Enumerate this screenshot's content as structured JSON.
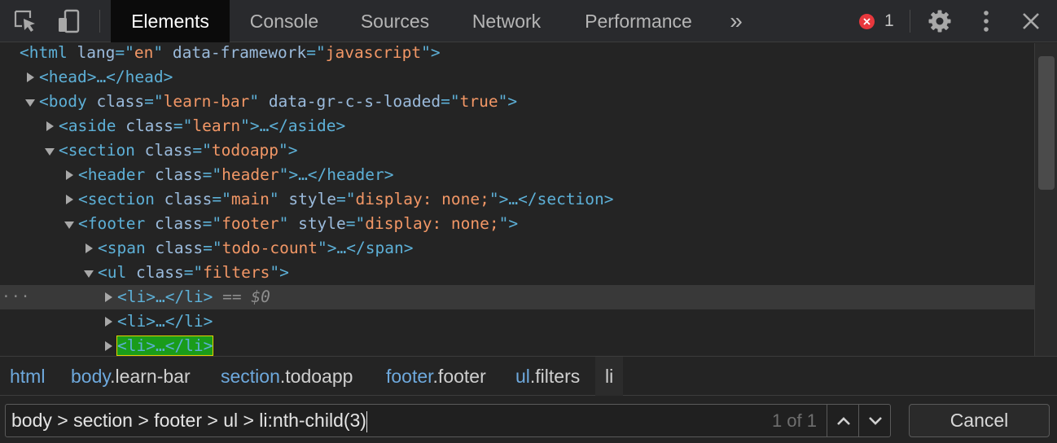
{
  "toolbar": {
    "tabs": [
      "Elements",
      "Console",
      "Sources",
      "Network",
      "Performance"
    ],
    "more_tabs_label": "»",
    "error_count": "1",
    "icons": [
      "inspect-element-icon",
      "device-toggle-icon",
      "gear-icon",
      "kebab-menu-icon",
      "close-icon"
    ]
  },
  "dom": {
    "html_open": {
      "tag": "<html",
      "attrs": [
        [
          "lang",
          "en"
        ],
        [
          "data-framework",
          "javascript"
        ]
      ],
      "close": ">"
    },
    "head": "<head>…</head>",
    "body_open": {
      "tag": "<body",
      "attrs": [
        [
          "class",
          "learn-bar"
        ],
        [
          "data-gr-c-s-loaded",
          "true"
        ]
      ],
      "close": ">"
    },
    "aside": {
      "tag": "<aside",
      "attrs": [
        [
          "class",
          "learn"
        ]
      ],
      "tail": ">…</aside>"
    },
    "section_open": {
      "tag": "<section",
      "attrs": [
        [
          "class",
          "todoapp"
        ]
      ],
      "close": ">"
    },
    "header": {
      "tag": "<header",
      "attrs": [
        [
          "class",
          "header"
        ]
      ],
      "tail": ">…</header>"
    },
    "section_main": {
      "tag": "<section",
      "attrs": [
        [
          "class",
          "main"
        ],
        [
          "style",
          "display: none;"
        ]
      ],
      "tail": ">…</section>"
    },
    "footer_open": {
      "tag": "<footer",
      "attrs": [
        [
          "class",
          "footer"
        ],
        [
          "style",
          "display: none;"
        ]
      ],
      "close": ">"
    },
    "span": {
      "tag": "<span",
      "attrs": [
        [
          "class",
          "todo-count"
        ]
      ],
      "tail": ">…</span>"
    },
    "ul_open": {
      "tag": "<ul",
      "attrs": [
        [
          "class",
          "filters"
        ]
      ],
      "close": ">"
    },
    "li_1": "<li>…</li>",
    "li_1_marker": "== $0",
    "li_2": "<li>…</li>",
    "li_3": "<li>…</li>",
    "selected_dots": "···"
  },
  "breadcrumbs": [
    {
      "tag": "html",
      "cls": ""
    },
    {
      "tag": "body",
      "cls": ".learn-bar"
    },
    {
      "tag": "section",
      "cls": ".todoapp"
    },
    {
      "tag": "footer",
      "cls": ".footer"
    },
    {
      "tag": "ul",
      "cls": ".filters"
    },
    {
      "tag": "li",
      "cls": ""
    }
  ],
  "search": {
    "value": "body > section > footer > ul > li:nth-child(3)",
    "match_count": "1 of 1",
    "cancel_label": "Cancel"
  },
  "colors": {
    "tag": "#5db0d7",
    "attr_name": "#9bbbdc",
    "attr_value": "#f29766",
    "highlight": "#1a9c1a",
    "error": "#e8383d"
  }
}
